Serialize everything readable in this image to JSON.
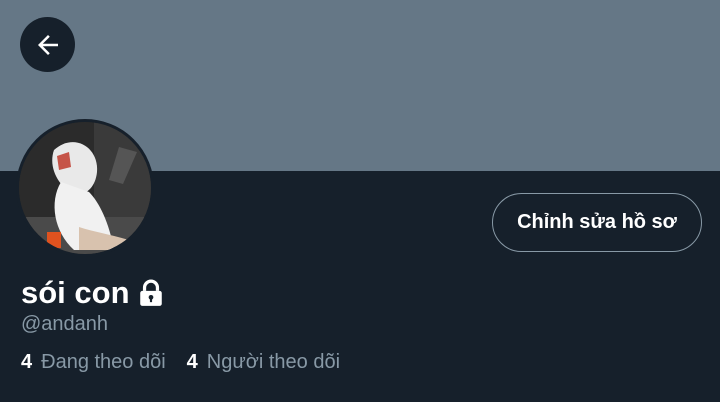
{
  "header": {
    "back_icon": "arrow-left-icon"
  },
  "profile": {
    "display_name": "sói con",
    "lock_icon": "lock-icon",
    "handle": "@andanh",
    "edit_button_label": "Chỉnh sửa hồ sơ"
  },
  "stats": {
    "following_count": "4",
    "following_label": "Đang theo dõi",
    "followers_count": "4",
    "followers_label": "Người theo dõi"
  },
  "colors": {
    "banner": "#657786",
    "background": "#16202b",
    "secondary_text": "#8899a6",
    "primary_text": "#ffffff"
  }
}
